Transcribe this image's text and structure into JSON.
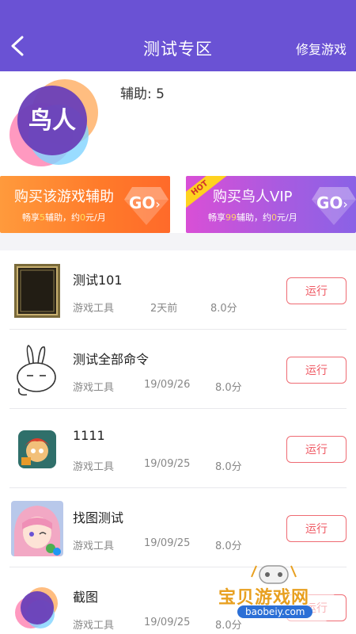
{
  "header": {
    "title": "测试专区",
    "repair_label": "修复游戏",
    "bg_color": "#6a52d4"
  },
  "profile": {
    "logo_text": "鸟人",
    "helper_text": "辅助: 5"
  },
  "banners": [
    {
      "title": "购买该游戏辅助",
      "sub_prefix": "畅享",
      "sub_highlight1": "5",
      "sub_middle": "辅助，约",
      "sub_highlight2": "0",
      "sub_suffix": "元/月",
      "go_label": "GO",
      "color": "#ff7a2a"
    },
    {
      "tag": "HOT",
      "title": "购买鸟人VIP",
      "sub_prefix": "畅享",
      "sub_highlight1": "99",
      "sub_middle": "辅助，约",
      "sub_highlight2": "0",
      "sub_suffix": "元/月",
      "go_label": "GO",
      "color": "#a95be0"
    }
  ],
  "run_label": "运行",
  "apps": [
    {
      "name": "测试101",
      "category": "游戏工具",
      "date": "2天前",
      "score": "8.0分",
      "icon": "frame-icon"
    },
    {
      "name": "测试全部命令",
      "category": "游戏工具",
      "date": "19/09/26",
      "score": "8.0分",
      "icon": "rabbit-icon"
    },
    {
      "name": "1111",
      "category": "游戏工具",
      "date": "19/09/25",
      "score": "8.0分",
      "icon": "game-character-icon"
    },
    {
      "name": "找图测试",
      "category": "游戏工具",
      "date": "19/09/25",
      "score": "8.0分",
      "icon": "anime-girl-icon"
    },
    {
      "name": "截图",
      "category": "游戏工具",
      "date": "19/09/25",
      "score": "8.0分",
      "icon": "colorful-circles-icon"
    }
  ],
  "watermark": {
    "text": "宝贝游戏网",
    "url": "baobeiy.com"
  }
}
